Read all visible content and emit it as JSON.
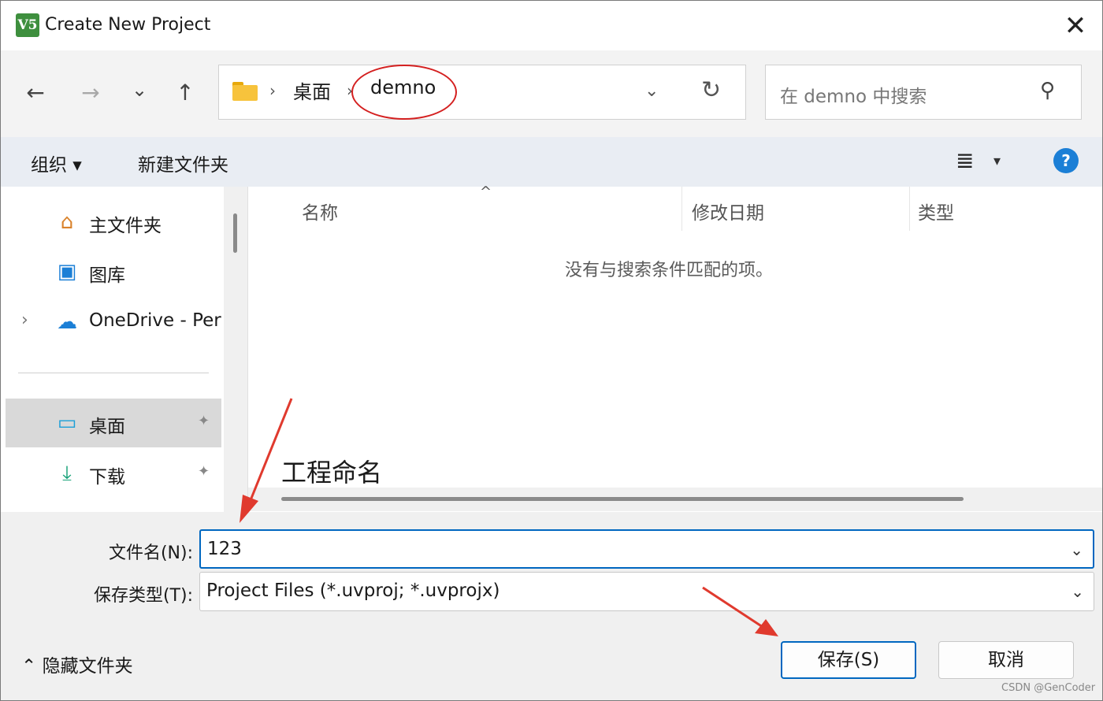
{
  "window": {
    "title": "Create New Project",
    "app_icon_text": "V5",
    "close_glyph": "✕"
  },
  "nav": {
    "back_glyph": "←",
    "forward_glyph": "→",
    "recent_glyph": "⌄",
    "up_glyph": "↑",
    "breadcrumb": [
      "桌面",
      "demno"
    ],
    "breadcrumb_sep": "›",
    "dropdown_glyph": "⌄",
    "refresh_glyph": "↻",
    "search_placeholder": "在 demno 中搜索",
    "search_glyph": "⚲"
  },
  "toolbar": {
    "organize_label": "组织 ▾",
    "new_folder_label": "新建文件夹",
    "view_glyph": "≣",
    "view_dd_glyph": "▾",
    "help_glyph": "?"
  },
  "sidebar": {
    "items": [
      {
        "label": "主文件夹",
        "icon": "home-icon",
        "glyph": "⌂"
      },
      {
        "label": "图库",
        "icon": "gallery-icon",
        "glyph": "▣"
      },
      {
        "label": "OneDrive - Personal",
        "icon": "onedrive-cloud-icon",
        "glyph": "☁"
      },
      {
        "label": "桌面",
        "icon": "desktop-icon",
        "glyph": "▭",
        "pinned": true,
        "active": true
      },
      {
        "label": "下载",
        "icon": "download-icon",
        "glyph": "⤓",
        "pinned": true
      }
    ],
    "expand_glyph": "›",
    "pin_glyph": "📌"
  },
  "filelist": {
    "columns": [
      "名称",
      "修改日期",
      "类型"
    ],
    "sort_glyph": "^",
    "empty_message": "没有与搜索条件匹配的项。"
  },
  "annotation": {
    "text": "工程命名",
    "arrow_color": "#e03a2e",
    "ellipse_color": "#d42020"
  },
  "form": {
    "filename_label": "文件名(N):",
    "filename_value": "123",
    "filetype_label": "保存类型(T):",
    "filetype_value": "Project Files (*.uvproj; *.uvprojx)",
    "dropdown_glyph": "⌄"
  },
  "footer": {
    "hide_folders_label": "⌃ 隐藏文件夹",
    "save_label": "保存(S)",
    "cancel_label": "取消",
    "watermark": "CSDN @GenCoder"
  },
  "colors": {
    "accent": "#0067c0",
    "toolbar_bg": "#e9edf3",
    "selected_bg": "#d9d9d9"
  }
}
